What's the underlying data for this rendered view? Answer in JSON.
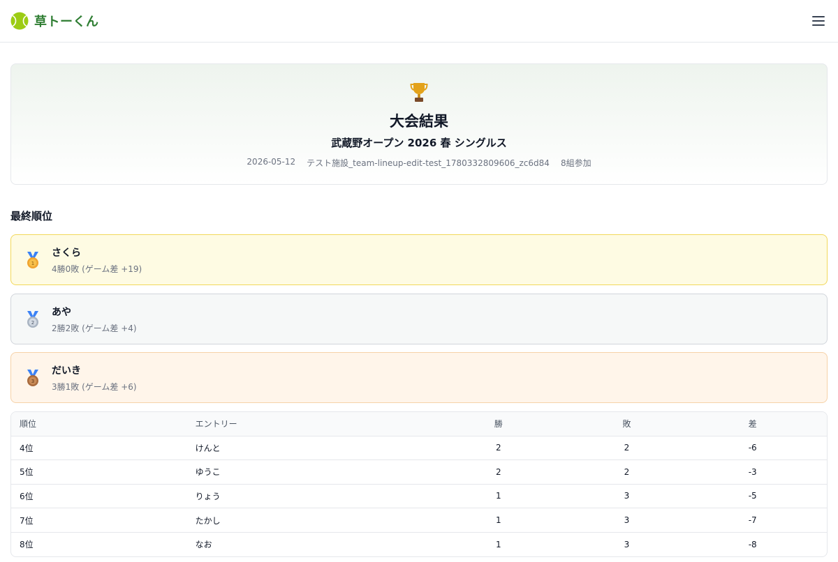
{
  "header": {
    "app_name": "草トーくん",
    "icons": {
      "logo": "tennis-ball-icon",
      "menu": "hamburger-menu-icon"
    },
    "brand_color": "#2e7d32"
  },
  "result": {
    "icon": "trophy-icon",
    "title": "大会結果",
    "event_name": "武蔵野オープン 2026 春 シングルス",
    "date": "2026-05-12",
    "venue": "テスト施設_team-lineup-edit-test_1780332809606_zc6d84",
    "participants": "8組参加"
  },
  "final_ranking": {
    "title": "最終順位",
    "podium": [
      {
        "medal": "gold-medal-icon",
        "name": "さくら",
        "record": "4勝0敗 (ゲーム差 +19)",
        "color": "#fefbe3"
      },
      {
        "medal": "silver-medal-icon",
        "name": "あや",
        "record": "2勝2敗 (ゲーム差 +4)",
        "color": "#f6f8f8"
      },
      {
        "medal": "bronze-medal-icon",
        "name": "だいき",
        "record": "3勝1敗 (ゲーム差 +6)",
        "color": "#fff5ea"
      }
    ]
  },
  "table": {
    "headers": {
      "rank": "順位",
      "entry": "エントリー",
      "wins": "勝",
      "losses": "敗",
      "diff": "差"
    },
    "rows": [
      {
        "rank": "4位",
        "entry": "けんと",
        "wins": "2",
        "losses": "2",
        "diff": "-6"
      },
      {
        "rank": "5位",
        "entry": "ゆうこ",
        "wins": "2",
        "losses": "2",
        "diff": "-3"
      },
      {
        "rank": "6位",
        "entry": "りょう",
        "wins": "1",
        "losses": "3",
        "diff": "-5"
      },
      {
        "rank": "7位",
        "entry": "たかし",
        "wins": "1",
        "losses": "3",
        "diff": "-7"
      },
      {
        "rank": "8位",
        "entry": "なお",
        "wins": "1",
        "losses": "3",
        "diff": "-8"
      }
    ]
  }
}
